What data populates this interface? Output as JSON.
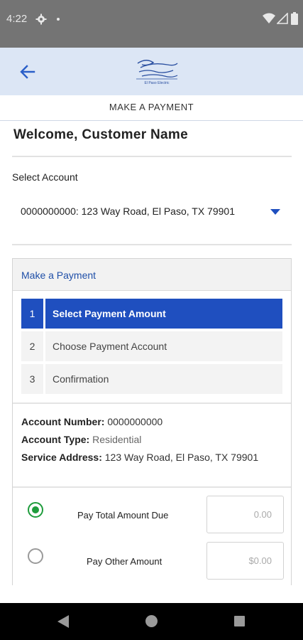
{
  "status_bar": {
    "time": "4:22"
  },
  "header": {
    "logo_sub": "El Paso Electric"
  },
  "page_title": "MAKE A PAYMENT",
  "welcome": "Welcome, Customer Name",
  "select_account": {
    "label": "Select Account",
    "value": "0000000000: 123 Way Road, El Paso, TX 79901"
  },
  "card": {
    "title": "Make a Payment",
    "steps": [
      {
        "num": "1",
        "label": "Select Payment Amount",
        "active": true
      },
      {
        "num": "2",
        "label": "Choose Payment Account",
        "active": false
      },
      {
        "num": "3",
        "label": "Confirmation",
        "active": false
      }
    ],
    "account_number_label": "Account Number:",
    "account_number": "0000000000",
    "account_type_label": "Account Type:",
    "account_type": "Residential",
    "service_address_label": "Service Address:",
    "service_address": "123 Way Road, El Paso, TX 79901",
    "options": [
      {
        "label": "Pay Total Amount Due",
        "amount": "0.00",
        "selected": true
      },
      {
        "label": "Pay Other Amount",
        "placeholder": "$0.00",
        "selected": false
      }
    ]
  },
  "colors": {
    "accent": "#1f4fbf",
    "header_bg": "#dce6f5",
    "radio_on": "#1e9c3c",
    "link": "#1f4fa8"
  }
}
